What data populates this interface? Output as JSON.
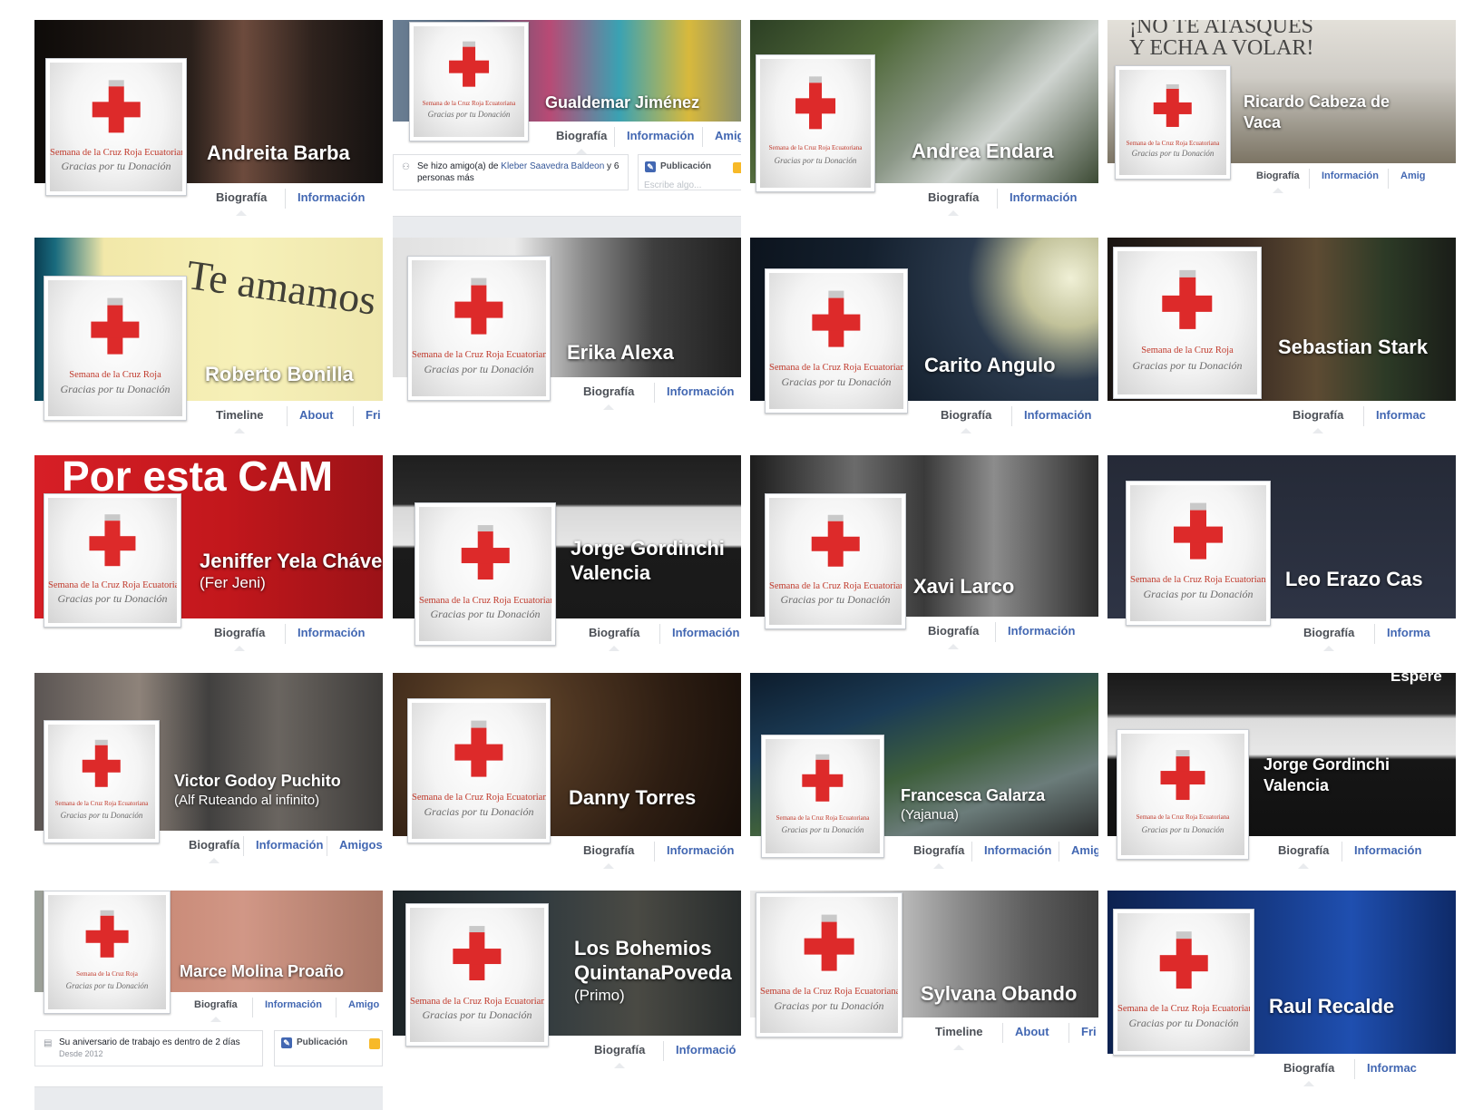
{
  "logo": {
    "org": "Semana de la Cruz Roja Ecuatoriana",
    "org_short": "Semana de la Cruz Roja",
    "thanks": "Gracias por tu Donación"
  },
  "colors": {
    "link": "#4267b2",
    "cross": "#dd2a2a",
    "tab_text": "#4b4f56",
    "background": "#e9ebee"
  },
  "icons": {
    "cross": "red-cross-icon",
    "friends": "friends-icon",
    "work": "briefcase-icon",
    "publish": "pencil-icon",
    "photo": "photo-icon"
  },
  "cards": [
    {
      "name": "Andreita Barba",
      "tabs": [
        "Biografía",
        "Información"
      ]
    },
    {
      "name": "Gualdemar Jiménez",
      "tabs": [
        "Biografía",
        "Información",
        "Amig"
      ],
      "feed": {
        "prefix": "Se hizo amigo(a) de",
        "link": "Kleber Saavedra Baldeon",
        "suffix": "y 6",
        "line2": "personas más"
      },
      "publish": {
        "label": "Publicación",
        "placeholder": "Escribe algo..."
      }
    },
    {
      "name": "Andrea Endara",
      "tabs": [
        "Biografía",
        "Información"
      ]
    },
    {
      "name": "Ricardo Cabeza de",
      "name2": "Vaca",
      "cover_text": [
        "¡NO TE ATASQUES",
        "Y ECHA A VOLAR!"
      ],
      "tabs": [
        "Biografía",
        "Información",
        "Amig"
      ]
    },
    {
      "name": "Roberto Bonilla",
      "cover_text": [
        "Te amamos"
      ],
      "tabs": [
        "Timeline",
        "About",
        "Fri"
      ]
    },
    {
      "name": "Erika Alexa",
      "tabs": [
        "Biografía",
        "Información"
      ]
    },
    {
      "name": "Carito Angulo",
      "tabs": [
        "Biografía",
        "Información"
      ]
    },
    {
      "name": "Sebastian Stark",
      "tabs": [
        "Biografía",
        "Informac"
      ]
    },
    {
      "name": "Jeniffer Yela Chávez",
      "subtitle": "(Fer Jeni)",
      "cover_text": [
        "Por esta CAM"
      ],
      "tabs": [
        "Biografía",
        "Información"
      ]
    },
    {
      "name": "Jorge Gordinchi",
      "name2": "Valencia",
      "tabs": [
        "Biografía",
        "Información"
      ]
    },
    {
      "name": "Xavi Larco",
      "tabs": [
        "Biografía",
        "Información"
      ]
    },
    {
      "name": "Leo Erazo Cas",
      "tabs": [
        "Biografía",
        "Informa"
      ]
    },
    {
      "name": "Victor Godoy Puchito",
      "subtitle": "(Alf Ruteando al infinito)",
      "tabs": [
        "Biografía",
        "Información",
        "Amigos"
      ]
    },
    {
      "name": "Danny Torres",
      "tabs": [
        "Biografía",
        "Información"
      ]
    },
    {
      "name": "Francesca Galarza",
      "subtitle": "(Yajanua)",
      "tabs": [
        "Biografía",
        "Información",
        "Amig"
      ]
    },
    {
      "name": "Jorge Gordinchi",
      "name2": "Valencia",
      "cover_text": [
        "Espere"
      ],
      "tabs": [
        "Biografía",
        "Información"
      ]
    },
    {
      "name": "Marce Molina Proaño",
      "tabs": [
        "Biografía",
        "Información",
        "Amigo"
      ],
      "feed": {
        "prefix": "Su aniversario de trabajo es dentro de 2 días",
        "line2": "Desde 2012"
      },
      "publish": {
        "label": "Publicación"
      }
    },
    {
      "name": "Los Bohemios",
      "name2": "QuintanaPoveda",
      "subtitle": "(Primo)",
      "tabs": [
        "Biografía",
        "Informació"
      ]
    },
    {
      "name": "Sylvana Obando",
      "tabs": [
        "Timeline",
        "About",
        "Fri"
      ]
    },
    {
      "name": "Raul Recalde",
      "tabs": [
        "Biografía",
        "Informac"
      ]
    }
  ]
}
